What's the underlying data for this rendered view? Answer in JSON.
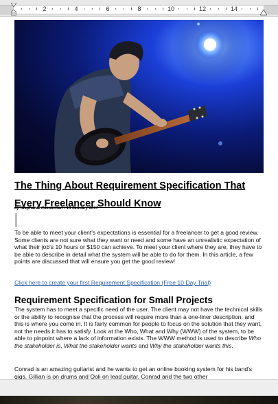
{
  "ruler": {
    "numbers": [
      "2",
      "4",
      "6",
      "8",
      "10",
      "12",
      "14"
    ]
  },
  "article": {
    "image_alt": "guitarist-photo",
    "title": "The Thing About Requirement Specification That Every Freelancer Should Know",
    "byline": "by Stephanie Kasselman / 13 January 2017",
    "intro": "To be able to meet your client's expectations is essential for a freelancer to get a good review. Some clients are not sure what they want or need and some have an unrealistic expectation of what their job's 10 hours or $150 can achieve.  To meet your client where they are, they have to be able to describe in detail what the system will be able to do for them. In this article, a few points are discussed that will ensure you get the good review!",
    "cta_link": "Click here to create your first Requirement Specification (Free 10 Day Trial)",
    "section_heading": "Requirement Specification for Small Projects",
    "section_p1_a": "The system has to meet a specific need of the user. The client may not have the technical skills or the ability to recognise that the process will require more than a one-liner description, and this is where you come in. It is fairly common for people to focus on the solution that they want, not the needs it has to satisfy. Look at the Who, What and Why (WWW) of the system, to be able to pinpoint where a lack of information exists. The WWW method is used to describe ",
    "section_p1_em1": "Who the stakeholder is",
    "section_p1_sep1": ", ",
    "section_p1_em2": "What the stakeholder wants",
    "section_p1_and": " and ",
    "section_p1_em3": "Why the stakeholder wants this",
    "section_p1_end": ".",
    "section_p2": "Conrad is an amazing guitarist and he wants to get an online booking system for his band's gigs.   Gillian is on drums and Qoli on lead guitar. Conrad and the two other"
  },
  "colors": {
    "link": "#2f5fa7",
    "stage_blue": "#1b3fd8"
  }
}
